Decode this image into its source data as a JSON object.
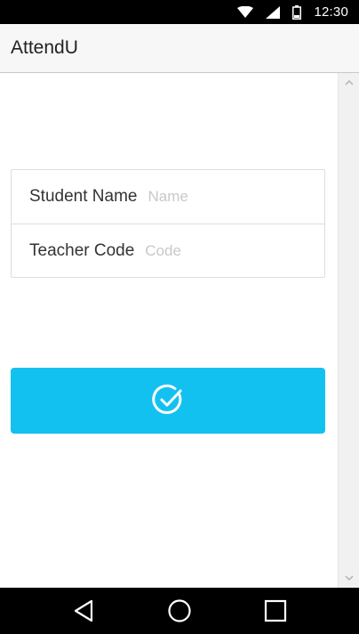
{
  "status_bar": {
    "time": "12:30",
    "icons": [
      "wifi-icon",
      "signal-icon",
      "battery-icon"
    ]
  },
  "app_bar": {
    "title": "AttendU"
  },
  "form": {
    "student_name": {
      "label": "Student Name",
      "placeholder": "Name",
      "value": ""
    },
    "teacher_code": {
      "label": "Teacher Code",
      "placeholder": "Code",
      "value": ""
    }
  },
  "submit_button": {
    "icon": "check-circle-icon",
    "color": "#13c1f0"
  },
  "nav_bar": {
    "buttons": [
      "back-icon",
      "home-icon",
      "recents-icon"
    ]
  },
  "colors": {
    "accent": "#13c1f0",
    "app_bar_bg": "#f7f7f7",
    "system_bars": "#000000"
  }
}
